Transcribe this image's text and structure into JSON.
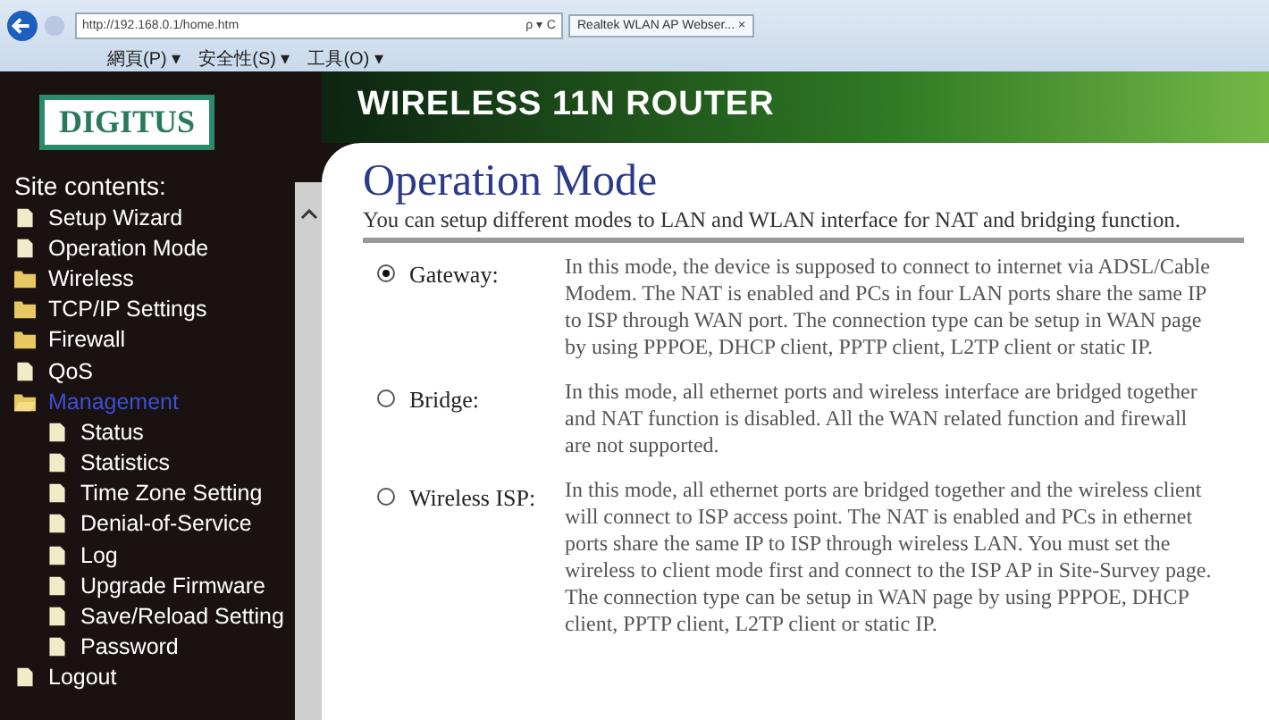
{
  "browser": {
    "address": "http://192.168.0.1/home.htm",
    "search_glyph": "ρ ▾ C",
    "tab_title": "Realtek WLAN AP Webser...",
    "tab_close": "×",
    "menus": [
      "網頁(P) ▾",
      "安全性(S) ▾",
      "工具(O) ▾"
    ]
  },
  "header": {
    "logo": "DIGITUS",
    "banner": "WIRELESS 11N ROUTER"
  },
  "sidebar": {
    "title": "Site contents:",
    "items": [
      {
        "label": "Setup Wizard",
        "kind": "page",
        "selected": false
      },
      {
        "label": "Operation Mode",
        "kind": "page",
        "selected": false
      },
      {
        "label": "Wireless",
        "kind": "folder",
        "selected": false
      },
      {
        "label": "TCP/IP Settings",
        "kind": "folder",
        "selected": false
      },
      {
        "label": "Firewall",
        "kind": "folder",
        "selected": false
      },
      {
        "label": "QoS",
        "kind": "page",
        "selected": false
      },
      {
        "label": "Management",
        "kind": "folder",
        "selected": true,
        "expanded": true,
        "children": [
          {
            "label": "Status",
            "kind": "page",
            "selected": false
          },
          {
            "label": "Statistics",
            "kind": "page",
            "selected": false
          },
          {
            "label": "Time Zone Setting",
            "kind": "page",
            "selected": false
          },
          {
            "label": "Denial-of-Service",
            "kind": "page",
            "selected": false
          },
          {
            "label": "Log",
            "kind": "page",
            "selected": false
          },
          {
            "label": "Upgrade Firmware",
            "kind": "page",
            "selected": false
          },
          {
            "label": "Save/Reload Setting",
            "kind": "page",
            "selected": false
          },
          {
            "label": "Password",
            "kind": "page",
            "selected": false
          }
        ]
      },
      {
        "label": "Logout",
        "kind": "page",
        "selected": false
      }
    ]
  },
  "content": {
    "title": "Operation Mode",
    "subtitle": "You can setup different modes to LAN and WLAN interface for NAT and bridging function.",
    "modes": [
      {
        "label": "Gateway:",
        "selected": true,
        "description": "In this mode, the device is supposed to connect to internet via ADSL/Cable Modem. The NAT is enabled and PCs in four LAN ports share the same IP to ISP through WAN port. The connection type can be setup in WAN page by using PPPOE, DHCP client, PPTP client, L2TP client or static IP."
      },
      {
        "label": "Bridge:",
        "selected": false,
        "description": "In this mode, all ethernet ports and wireless interface are bridged together and NAT function is disabled. All the WAN related function and firewall are not supported."
      },
      {
        "label": "Wireless ISP:",
        "selected": false,
        "description": "In this mode, all ethernet ports are bridged together and the wireless client will connect to ISP access point. The NAT is enabled and PCs in ethernet ports share the same IP to ISP through wireless LAN. You must set the wireless to client mode first and connect to the ISP AP in Site-Survey page. The connection type can be setup in WAN page by using PPPOE, DHCP client, PPTP client, L2TP client or static IP."
      }
    ]
  }
}
